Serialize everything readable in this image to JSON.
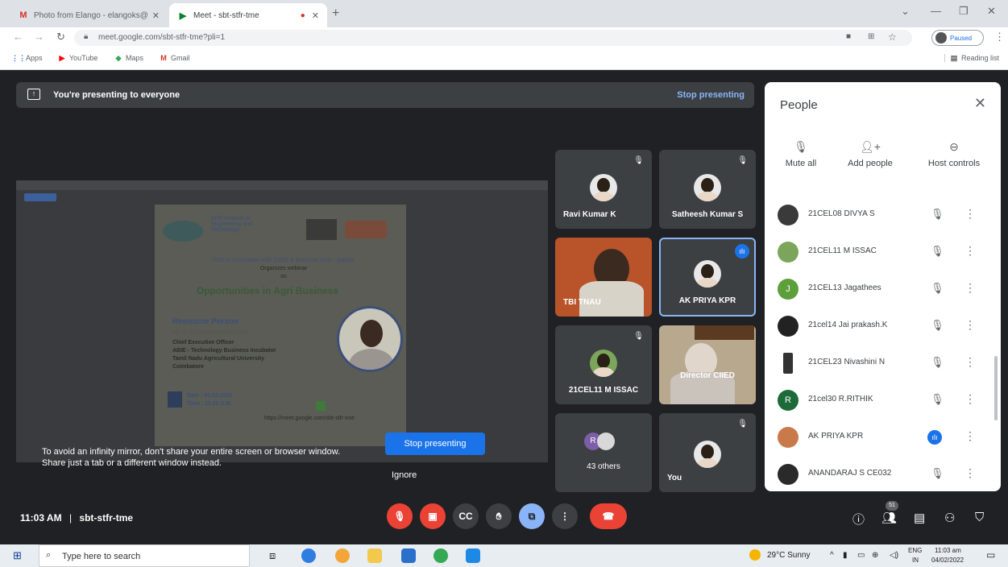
{
  "browser": {
    "tabs": [
      {
        "label": "Photo from Elango - elangoks@",
        "icon": "gmail-icon",
        "active": false
      },
      {
        "label": "Meet - sbt-stfr-tme",
        "icon": "meet-icon",
        "active": true
      }
    ],
    "url": "meet.google.com/sbt-stfr-tme?pli=1",
    "profile_status": "Paused",
    "bookmarks": [
      "Apps",
      "YouTube",
      "Maps",
      "Gmail"
    ],
    "reading_list": "Reading list"
  },
  "meet": {
    "presenting_text": "You're presenting to everyone",
    "stop_presenting_link": "Stop presenting",
    "mirror_warning": "To avoid an infinity mirror, don't share your entire screen or browser window. Share just a tab or a different window instead.",
    "stop_presenting_button": "Stop presenting",
    "ignore_button": "Ignore",
    "slide": {
      "institute": "KPR Institute of Engineering and Technology",
      "organizer": "EDC in association with CIIED & Business Club - Ipalinai",
      "organizes": "Organizes webinar",
      "on": "on",
      "title": "Opportunities in Agri Business",
      "resource_heading": "Resource Person",
      "person": "Mr. A.V.Gnanasambandam",
      "role1": "Chief Executive Officer",
      "role2": "ABIE - Technology Business Incubator",
      "role3": "Tamil Nadu Agricultural University",
      "role4": "Coimbatore",
      "date": "Date : 04.02.2022",
      "time": "Time : 11.00 A.M",
      "link": "https://meet.google.com/sbt-stfr-tme"
    },
    "tiles": [
      {
        "name": "Ravi Kumar K",
        "muted": true
      },
      {
        "name": "Satheesh Kumar S",
        "muted": true
      },
      {
        "name": "TBI TNAU",
        "muted": false
      },
      {
        "name": "AK PRIYA KPR",
        "muted": false
      },
      {
        "name": "21CEL11 M ISSAC",
        "muted": true
      },
      {
        "name": "Director CIIED",
        "muted": false
      },
      {
        "name": "43 others",
        "initial": "R"
      },
      {
        "name": "You",
        "muted": true
      }
    ],
    "clock": "11:03 AM",
    "meeting_code": "sbt-stfr-tme",
    "participant_count": "51"
  },
  "people_panel": {
    "title": "People",
    "actions": [
      {
        "label": "Mute all",
        "icon": "mute-all-icon"
      },
      {
        "label": "Add people",
        "icon": "add-people-icon"
      },
      {
        "label": "Host controls",
        "icon": "host-controls-icon"
      }
    ],
    "participants": [
      {
        "name": "21CEL08 DIVYA S",
        "avatar_color": "#3a3a3a",
        "initial": "",
        "speaking": false
      },
      {
        "name": "21CEL11 M ISSAC",
        "avatar_color": "#7aa55a",
        "initial": "",
        "speaking": false
      },
      {
        "name": "21CEL13 Jagathees",
        "avatar_color": "#5c9f3b",
        "initial": "J",
        "speaking": false
      },
      {
        "name": "21cel14 Jai prakash.K",
        "avatar_color": "#222222",
        "initial": "",
        "speaking": false
      },
      {
        "name": "21CEL23 Nivashini N",
        "avatar_color": "#333333",
        "initial": "",
        "speaking": false
      },
      {
        "name": "21cel30 R.RITHIK",
        "avatar_color": "#1e6b3a",
        "initial": "R",
        "speaking": false
      },
      {
        "name": "AK PRIYA KPR",
        "avatar_color": "#c97a4a",
        "initial": "",
        "speaking": true
      },
      {
        "name": "ANANDARAJ S CE032",
        "avatar_color": "#2a2a2a",
        "initial": "",
        "speaking": false
      }
    ]
  },
  "taskbar": {
    "search_placeholder": "Type here to search",
    "weather": "29°C Sunny",
    "lang": "ENG",
    "region": "IN",
    "time": "11:03 am",
    "date": "04/02/2022"
  }
}
